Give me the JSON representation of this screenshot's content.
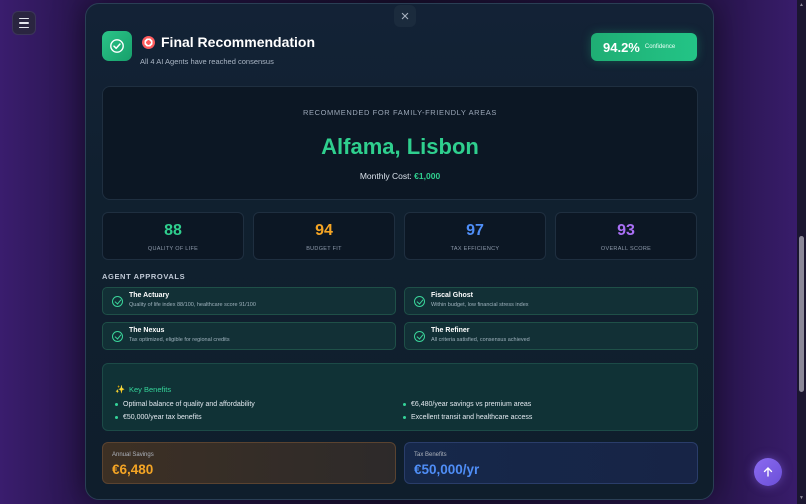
{
  "modal": {
    "close_glyph": "×",
    "title": "Final Recommendation",
    "title_emoji": "🎯",
    "subtitle": "All 4 AI Agents have reached consensus",
    "confidence": {
      "value": "94.2%",
      "label": "Confidence"
    }
  },
  "hero": {
    "eyebrow": "RECOMMENDED FOR FAMILY-FRIENDLY AREAS",
    "location": "Alfama, Lisbon",
    "cost_label": "Monthly Cost:",
    "cost_value": "€1,000"
  },
  "stats": [
    {
      "value": "88",
      "label": "QUALITY OF LIFE",
      "color": "#2fcf8e"
    },
    {
      "value": "94",
      "label": "BUDGET FIT",
      "color": "#f5a524"
    },
    {
      "value": "97",
      "label": "TAX EFFICIENCY",
      "color": "#4f8ef7"
    },
    {
      "value": "93",
      "label": "OVERALL SCORE",
      "color": "#a970f5"
    }
  ],
  "approvals": {
    "title": "AGENT APPROVALS",
    "items": [
      {
        "name": "The Actuary",
        "desc": "Quality of life index 88/100, healthcare score 91/100"
      },
      {
        "name": "Fiscal Ghost",
        "desc": "Within budget, low financial stress index"
      },
      {
        "name": "The Nexus",
        "desc": "Tax optimized, eligible for regional credits"
      },
      {
        "name": "The Refiner",
        "desc": "All criteria satisfied, consensus achieved"
      }
    ]
  },
  "benefits": {
    "icon": "✨",
    "title": "Key Benefits",
    "items": [
      "Optimal balance of quality and affordability",
      "€50,000/year tax benefits",
      "€6,480/year savings vs premium areas",
      "Excellent transit and healthcare access"
    ]
  },
  "savings": {
    "annual_label": "Annual Savings",
    "annual_value": "€6,480",
    "annual_color": "#f5a524",
    "tax_label": "Tax Benefits",
    "tax_value": "€50,000/yr",
    "tax_color": "#4f8ef7"
  }
}
